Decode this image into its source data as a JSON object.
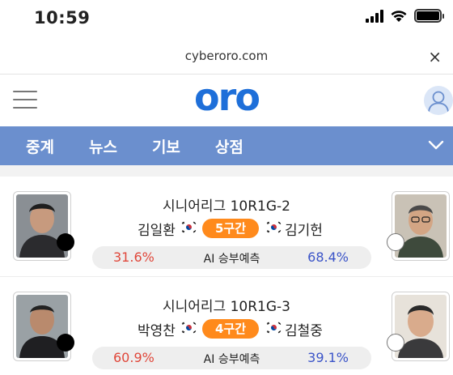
{
  "status_bar": {
    "time": "10:59"
  },
  "browser": {
    "url": "cyberoro.com",
    "close_symbol": "×"
  },
  "header": {
    "logo": "oro"
  },
  "nav": {
    "items": [
      "중계",
      "뉴스",
      "기보",
      "상점"
    ]
  },
  "matches": [
    {
      "title": "시니어리그 10R1G-2",
      "black_player": "김일환",
      "white_player": "김기헌",
      "section": "5구간",
      "black_win_pct": "31.6%",
      "white_win_pct": "68.4%",
      "prediction_label": "AI 승부예측"
    },
    {
      "title": "시니어리그 10R1G-3",
      "black_player": "박영찬",
      "white_player": "김철중",
      "section": "4구간",
      "black_win_pct": "60.9%",
      "white_win_pct": "39.1%",
      "prediction_label": "AI 승부예측"
    }
  ],
  "colors": {
    "brand": "#1e6fd9",
    "nav_bg": "#6b8fce",
    "section_badge": "#ff8a1c",
    "black_pct": "#e0473a",
    "white_pct": "#3b54c8"
  },
  "icons": {
    "status": [
      "signal-icon",
      "wifi-icon",
      "battery-icon"
    ],
    "header": [
      "menu-icon",
      "user-icon"
    ],
    "nav": "chevron-down-icon",
    "flag": "korea-flag-icon"
  }
}
